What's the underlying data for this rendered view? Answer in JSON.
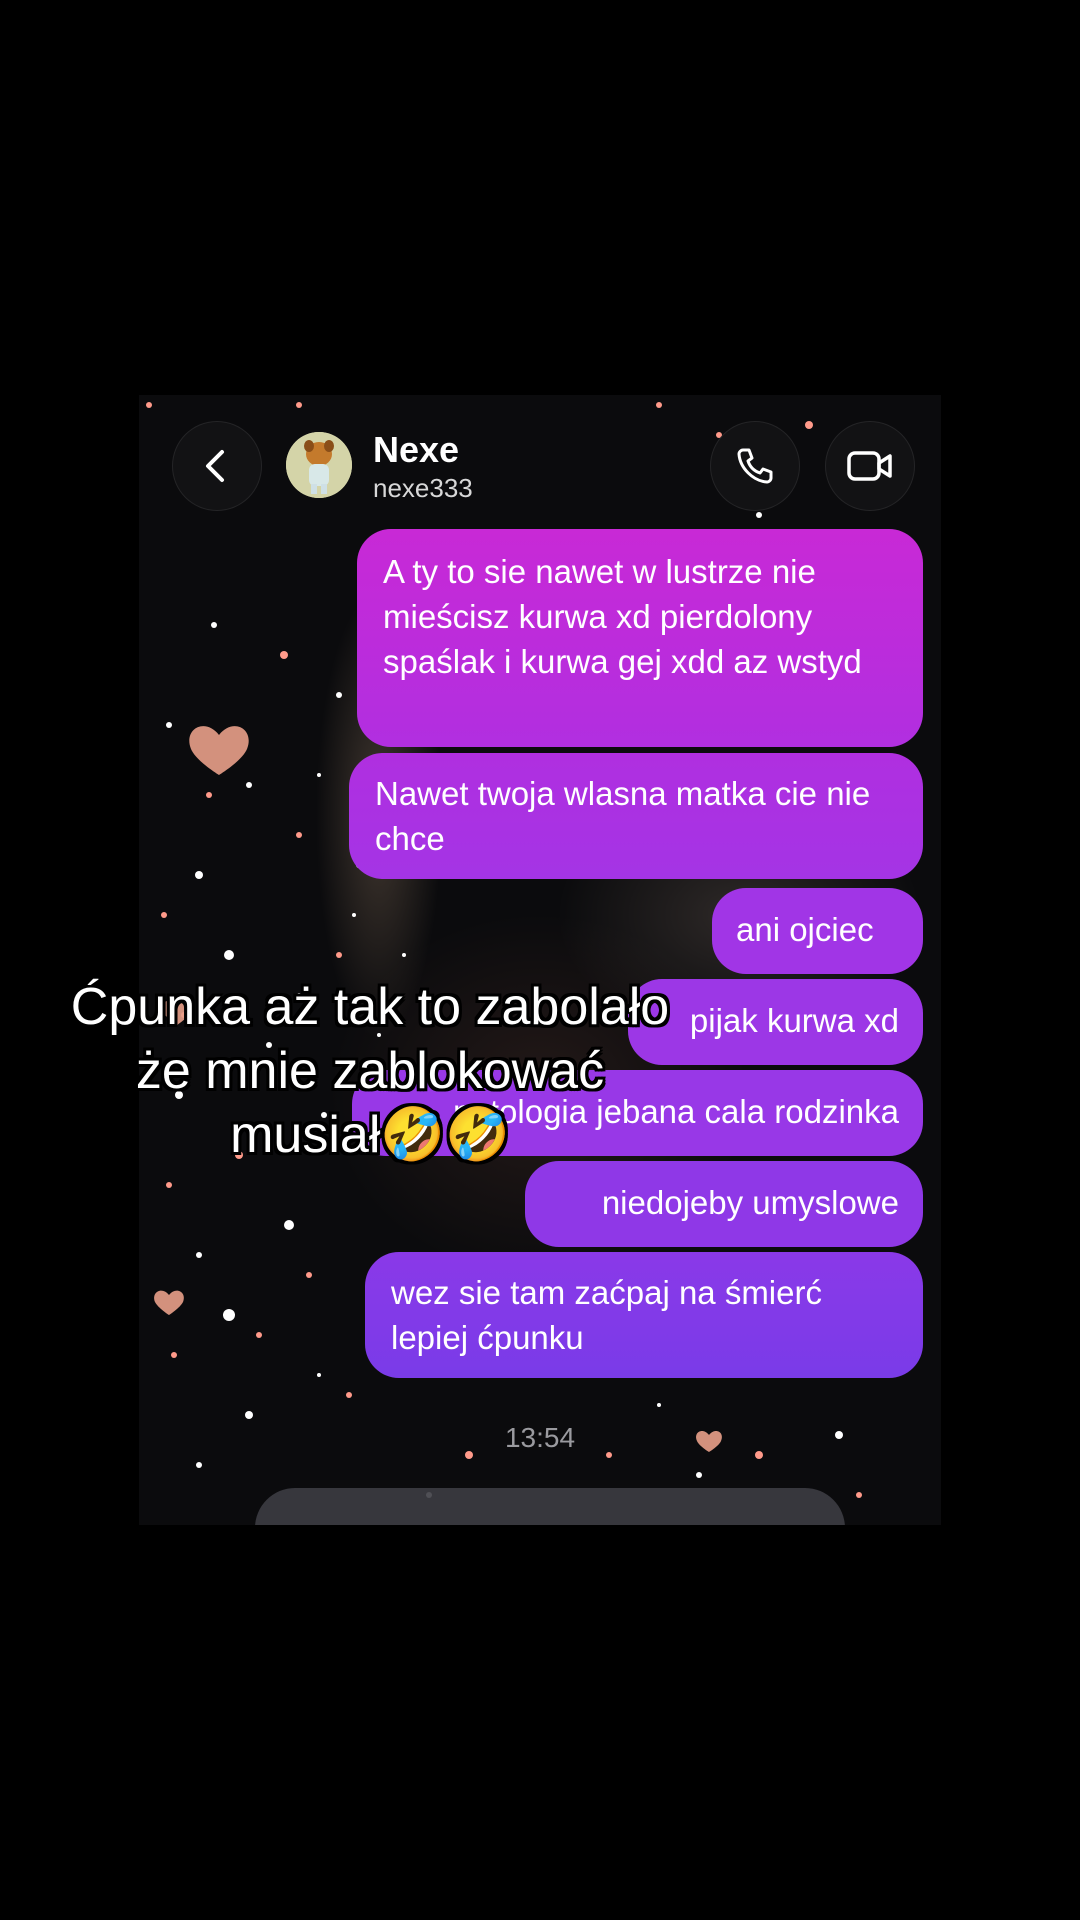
{
  "contact": {
    "name": "Nexe",
    "username": "nexe333"
  },
  "header": {
    "back_icon": "chevron-left-icon",
    "call_icon": "phone-icon",
    "video_icon": "video-camera-icon"
  },
  "messages": [
    {
      "text": "A ty to sie nawet w lustrze nie mieścisz kurwa xd pierdolony spaślak i kurwa gej xdd az wstyd",
      "sender": "me"
    },
    {
      "text": "Nawet twoja wlasna matka cie nie chce",
      "sender": "me"
    },
    {
      "text": "ani ojciec",
      "sender": "me"
    },
    {
      "text": "pijak kurwa xd",
      "sender": "me"
    },
    {
      "text": "patologia jebana cala rodzinka",
      "sender": "me"
    },
    {
      "text": "niedojeby umyslowe",
      "sender": "me"
    },
    {
      "text": "wez sie tam zaćpaj na śmierć lepiej ćpunku",
      "sender": "me"
    }
  ],
  "timestamp": "13:54",
  "caption": {
    "line1": "Ćpunka aż tak to zabolało",
    "line2": "że mnie zablokować",
    "line3": "musiał🤣🤣"
  },
  "colors": {
    "bubble_top": "#c327d8",
    "bubble_mid": "#a335e6",
    "bubble_bottom": "#7b3ae8",
    "background": "#000000"
  }
}
